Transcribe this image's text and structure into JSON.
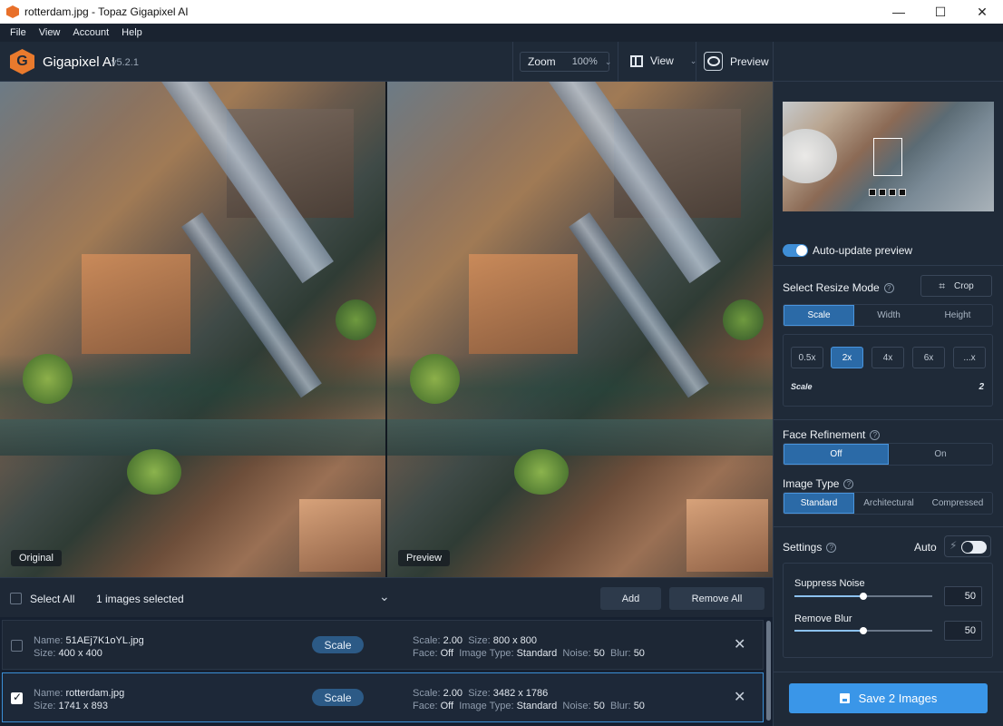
{
  "window": {
    "title": "rotterdam.jpg - Topaz Gigapixel AI",
    "controls": [
      "—",
      "☐",
      "✕"
    ]
  },
  "menu": [
    "File",
    "View",
    "Account",
    "Help"
  ],
  "header": {
    "logo_letter": "G",
    "app_name": "Gigapixel AI",
    "version": "v5.2.1",
    "zoom_label": "Zoom",
    "zoom_value": "100%",
    "view_label": "View",
    "preview_label": "Preview"
  },
  "viewports": {
    "left_label": "Original",
    "right_label": "Preview"
  },
  "selection": {
    "select_all": "Select All",
    "count_text": "1 images selected",
    "add": "Add",
    "remove_all": "Remove All"
  },
  "images": [
    {
      "checked": false,
      "name_label": "Name:",
      "name": "51AEj7K1oYL.jpg",
      "size_label": "Size:",
      "size": "400 x 400",
      "mode": "Scale",
      "scale_label": "Scale:",
      "scale": "2.00",
      "out_size_label": "Size:",
      "out_size": "800 x 800",
      "face_label": "Face:",
      "face": "Off",
      "type_label": "Image Type:",
      "type": "Standard",
      "noise_label": "Noise:",
      "noise": "50",
      "blur_label": "Blur:",
      "blur": "50"
    },
    {
      "checked": true,
      "name_label": "Name:",
      "name": "rotterdam.jpg",
      "size_label": "Size:",
      "size": "1741 x 893",
      "mode": "Scale",
      "scale_label": "Scale:",
      "scale": "2.00",
      "out_size_label": "Size:",
      "out_size": "3482 x 1786",
      "face_label": "Face:",
      "face": "Off",
      "type_label": "Image Type:",
      "type": "Standard",
      "noise_label": "Noise:",
      "noise": "50",
      "blur_label": "Blur:",
      "blur": "50"
    }
  ],
  "panel": {
    "auto_update": "Auto-update preview",
    "auto_update_on": true,
    "resize_mode_label": "Select Resize Mode",
    "crop": "Crop",
    "resize_modes": [
      "Scale",
      "Width",
      "Height"
    ],
    "resize_mode_active": "Scale",
    "scale_options": [
      "0.5x",
      "2x",
      "4x",
      "6x",
      "...x"
    ],
    "scale_active": "2x",
    "scale_label": "Scale",
    "scale_value": "2",
    "face_refinement_label": "Face Refinement",
    "face_options": [
      "Off",
      "On"
    ],
    "face_active": "Off",
    "image_type_label": "Image Type",
    "image_types": [
      "Standard",
      "Architectural",
      "Compressed"
    ],
    "image_type_active": "Standard",
    "settings_label": "Settings",
    "auto_label": "Auto",
    "auto_on": false,
    "suppress_noise_label": "Suppress Noise",
    "suppress_noise": "50",
    "suppress_noise_fraction": 0.5,
    "remove_blur_label": "Remove Blur",
    "remove_blur": "50",
    "remove_blur_fraction": 0.5,
    "save": "Save 2 Images"
  },
  "colors": {
    "accent": "#3a96e8",
    "active_segment": "#2b6aa7",
    "background": "#1f2a38",
    "logo": "#e97a2d"
  }
}
